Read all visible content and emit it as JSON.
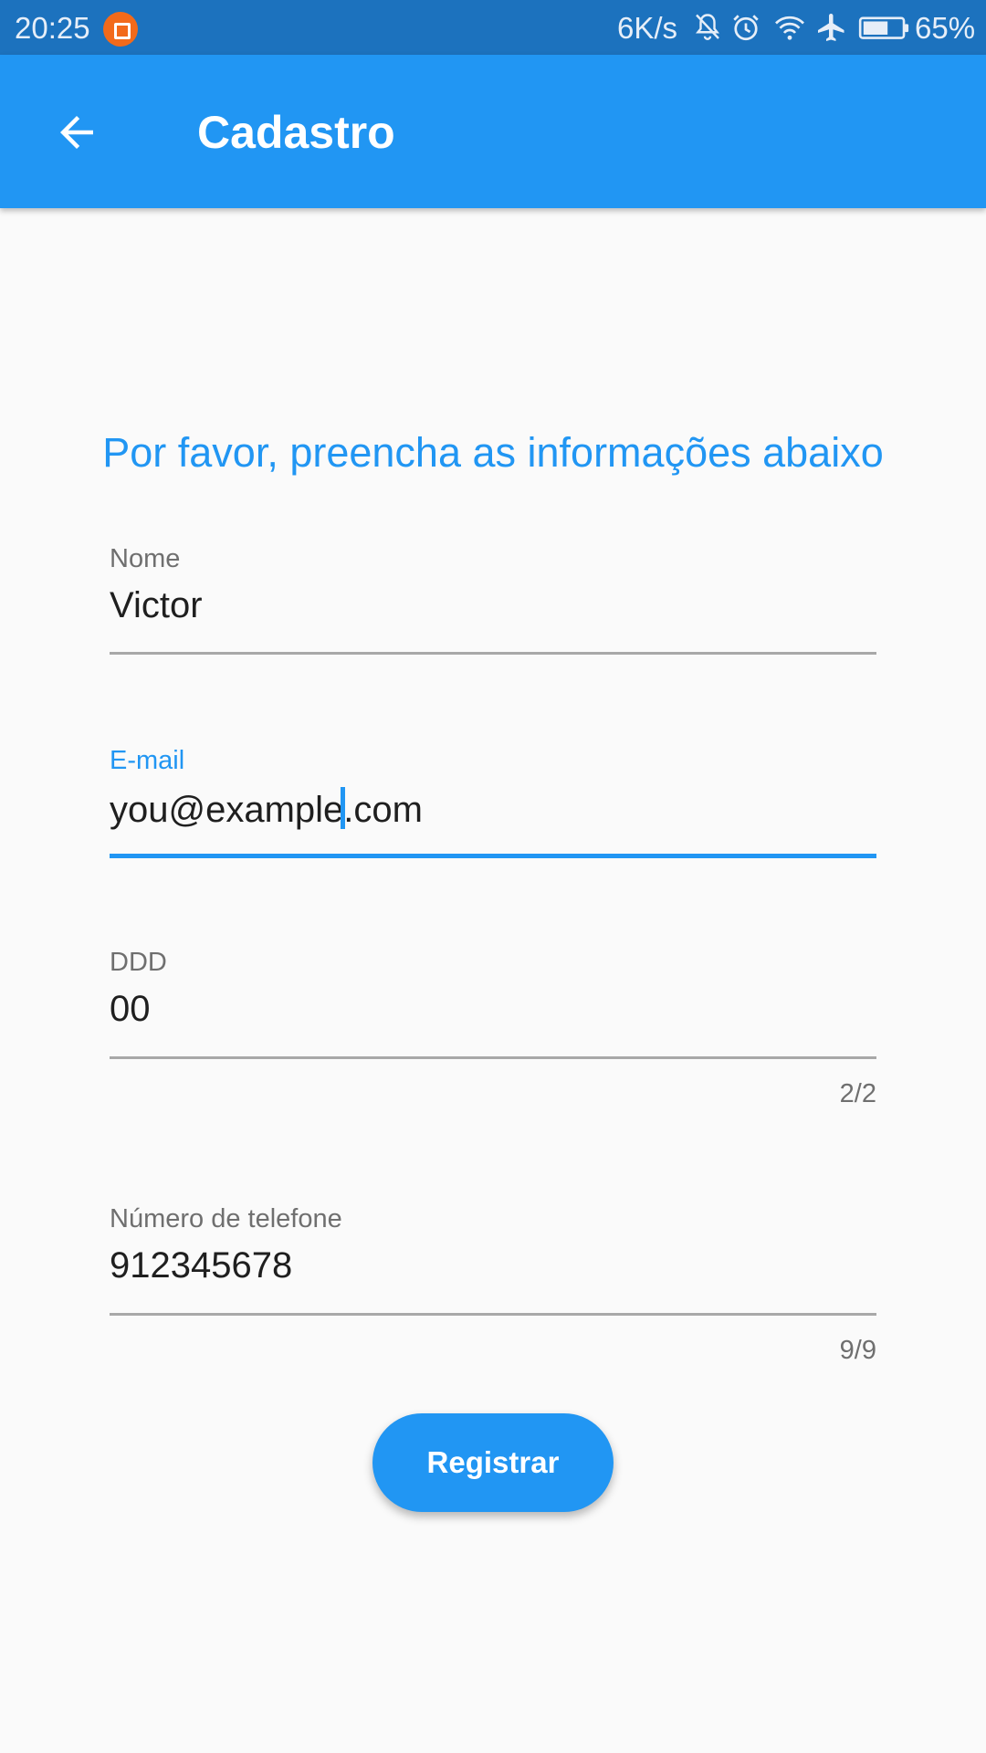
{
  "status_bar": {
    "time": "20:25",
    "network_speed": "6K/s",
    "battery_percent": "65%",
    "icons": [
      "notification-app-icon",
      "bell-off-icon",
      "alarm-icon",
      "wifi-icon",
      "airplane-icon",
      "battery-icon"
    ],
    "battery_level": 0.65
  },
  "app_bar": {
    "title": "Cadastro",
    "back_icon": "arrow-back-icon"
  },
  "intro_text": "Por favor, preencha as informações abaixo",
  "form": {
    "name": {
      "label": "Nome",
      "value": "Victor"
    },
    "email": {
      "label": "E-mail",
      "value_before_cursor": "you@example",
      "value_after_cursor": ".com"
    },
    "ddd": {
      "label": "DDD",
      "value": "00",
      "counter": "2/2"
    },
    "phone": {
      "label": "Número de telefone",
      "value": "912345678",
      "counter": "9/9"
    }
  },
  "register_button": "Registrar",
  "colors": {
    "primary": "#2196f3",
    "status_bar": "#1c72be",
    "background": "#fafafa"
  }
}
